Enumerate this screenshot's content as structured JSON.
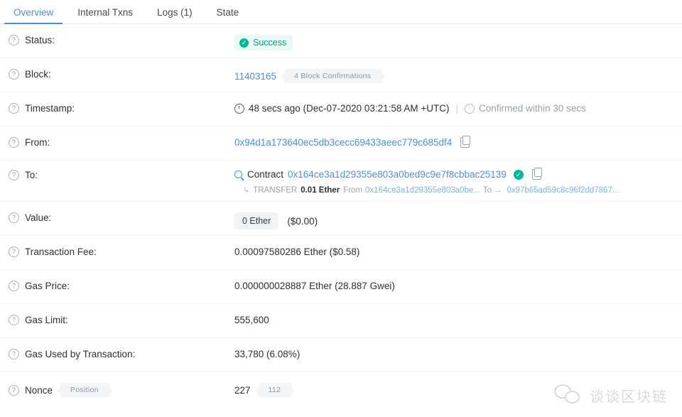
{
  "tabs": [
    {
      "label": "Overview",
      "active": true
    },
    {
      "label": "Internal Txns",
      "active": false
    },
    {
      "label": "Logs (1)",
      "active": false
    },
    {
      "label": "State",
      "active": false
    }
  ],
  "colors": {
    "accent": "#4a90d9",
    "success": "#00b99a",
    "success_bg": "#e8f9f5",
    "badge_bg": "#f2f3f5",
    "muted": "#9aa1a7"
  },
  "rows": {
    "status": {
      "label": "Status:",
      "badge": "Success"
    },
    "block": {
      "label": "Block:",
      "number": "11403165",
      "confirmations": "4 Block Confirmations"
    },
    "timestamp": {
      "label": "Timestamp:",
      "ago": "48 secs ago (Dec-07-2020 03:21:58 AM +UTC)",
      "separator": "|",
      "confirmed": "Confirmed within 30 secs"
    },
    "from": {
      "label": "From:",
      "address": "0x94d1a173640ec5db3cecc69433aeec779c685df4"
    },
    "to": {
      "label": "To:",
      "contract_word": "Contract",
      "address": "0x164ce3a1d29355e803a0bed9c9e7f8cbbac25139",
      "transfer": {
        "keyword": "TRANSFER",
        "amount": "0.01 Ether",
        "from_label": "From",
        "from_address": "0x164ce3a1d29355e803a0be...",
        "to_label": "To",
        "to_address": "0x97b65ad59c8c96f2dd7867..."
      }
    },
    "value": {
      "label": "Value:",
      "amount": "0 Ether",
      "fiat": "($0.00)"
    },
    "txn_fee": {
      "label": "Transaction Fee:",
      "text": "0.00097580286 Ether ($0.58)"
    },
    "gas_price": {
      "label": "Gas Price:",
      "text": "0.000000028887 Ether (28.887 Gwei)"
    },
    "gas_limit": {
      "label": "Gas Limit:",
      "text": "555,600"
    },
    "gas_used": {
      "label": "Gas Used by Transaction:",
      "text": "33,780 (6.08%)"
    },
    "nonce": {
      "label": "Nonce",
      "position_badge": "Position",
      "value": "227",
      "position_value": "112"
    }
  },
  "icons": {
    "help": "?",
    "check": "✓",
    "info": "i"
  },
  "watermark": {
    "text": "谈谈区块链"
  }
}
